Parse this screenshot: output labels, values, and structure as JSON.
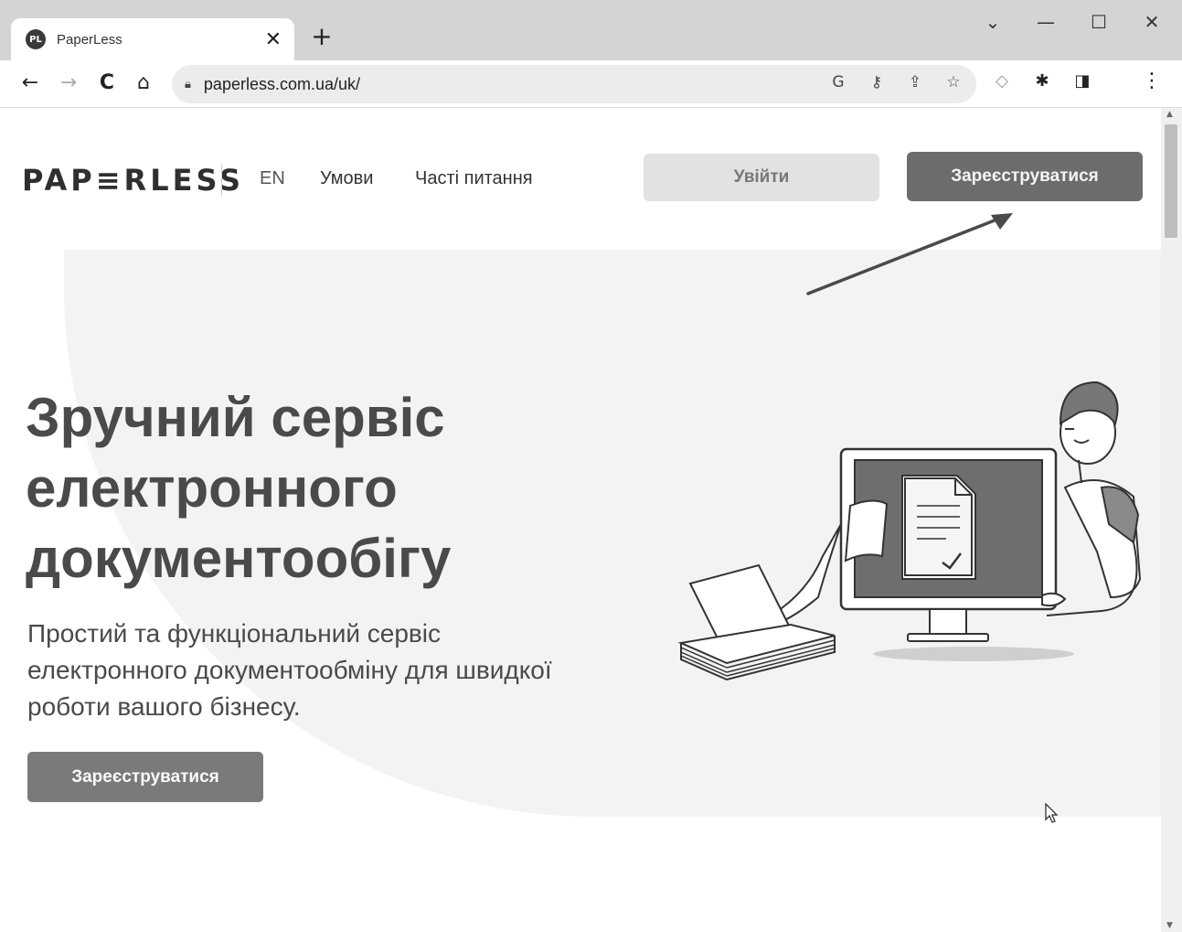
{
  "browser": {
    "tab_title": "PaperLess",
    "favicon_text": "PL",
    "tab_close": "✕",
    "new_tab": "+",
    "window_controls": {
      "dropdown": "⌄",
      "minimize": "—",
      "maximize": "☐",
      "close": "✕"
    },
    "nav": {
      "back": "←",
      "forward": "→",
      "reload": "C",
      "home": "⌂"
    },
    "url": "paperless.com.ua/uk/",
    "omnibox_icons": [
      "google-icon",
      "key-icon",
      "share-icon",
      "star-icon"
    ],
    "extension_icons": [
      "extension-icon",
      "puzzle-icon",
      "sidepanel-icon"
    ],
    "menu": "⋮"
  },
  "header": {
    "logo": "PAP≡RLESS",
    "lang": "EN",
    "terms": "Умови",
    "faq": "Часті питання",
    "login": "Увійти",
    "register": "Зареєструватися"
  },
  "hero": {
    "headline": [
      "Зручний сервіс",
      "електронного",
      "документообігу"
    ],
    "subtitle": [
      "Простий та функціональний сервіс",
      "електронного документообміну для швидкої",
      "роботи вашого бізнесу."
    ],
    "cta": "Зареєструватися"
  },
  "colors": {
    "primary_button": "#6c6c6c",
    "secondary_button": "#e2e2e2",
    "headline": "#4a4a4a"
  }
}
